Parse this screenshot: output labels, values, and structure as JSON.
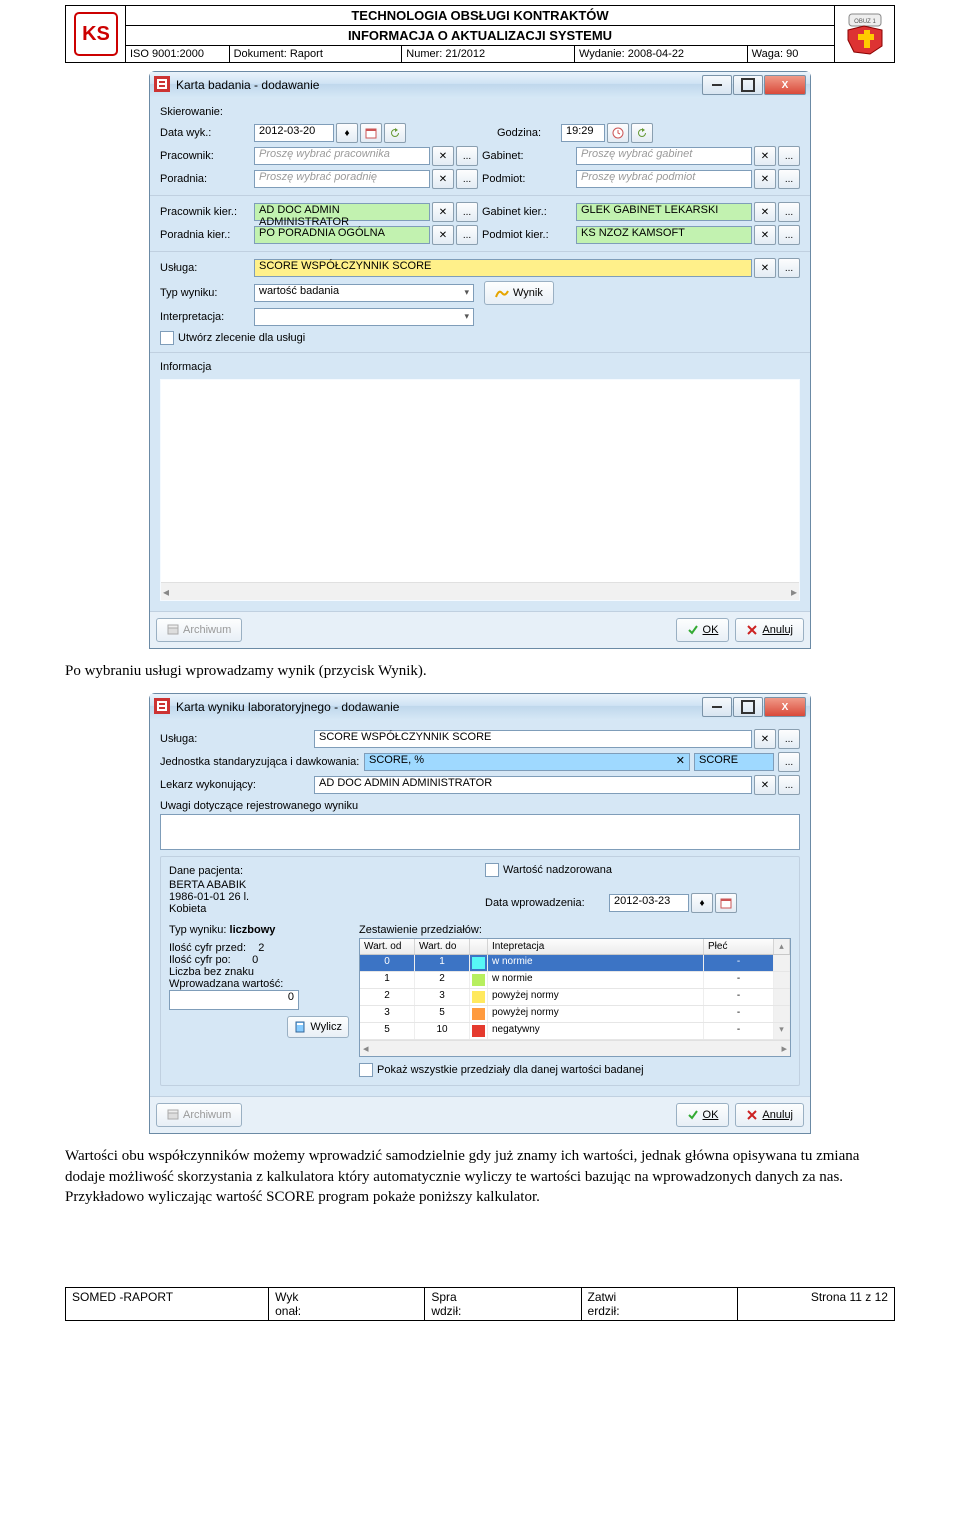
{
  "header": {
    "title1": "TECHNOLOGIA OBSŁUGI KONTRAKTÓW",
    "title2": "INFORMACJA O AKTUALIZACJI SYSTEMU",
    "iso": "ISO 9001:2000",
    "doc": "Dokument: Raport",
    "num": "Numer: 21/2012",
    "wyd": "Wydanie: 2008-04-22",
    "waga": "Waga: 90",
    "badge": "OBUZ 1"
  },
  "dlg1": {
    "title": "Karta badania - dodawanie",
    "sec_skier": "Skierowanie:",
    "l_data": "Data wyk.:",
    "v_data": "2012-03-20",
    "l_godz": "Godzina:",
    "v_godz": "19:29",
    "l_prac": "Pracownik:",
    "ph_prac": "Proszę wybrać pracownika",
    "l_gab": "Gabinet:",
    "ph_gab": "Proszę wybrać gabinet",
    "l_por": "Poradnia:",
    "ph_por": "Proszę wybrać poradnię",
    "l_pod": "Podmiot:",
    "ph_pod": "Proszę wybrać podmiot",
    "l_prack": "Pracownik kier.:",
    "v_prack": "AD DOC ADMIN ADMINISTRATOR",
    "l_gabk": "Gabinet kier.:",
    "v_gabk": "GLEK GABINET LEKARSKI",
    "l_pork": "Poradnia kier.:",
    "v_pork": "PO PORADNIA OGÓLNA",
    "l_podk": "Podmiot kier.:",
    "v_podk": "KS NZOZ KAMSOFT",
    "l_uslug": "Usługa:",
    "v_uslug": "SCORE WSPÓŁCZYNNIK SCORE",
    "l_typ": "Typ wyniku:",
    "v_typ": "wartość badania",
    "btn_wynik": "Wynik",
    "l_interp": "Interpretacja:",
    "chk_zlec": "Utwórz zlecenie dla usługi",
    "l_info": "Informacja",
    "btn_arch": "Archiwum",
    "btn_ok": "OK",
    "btn_anul": "Anuluj"
  },
  "para1": "Po wybraniu usługi wprowadzamy wynik (przycisk Wynik).",
  "dlg2": {
    "title": "Karta wyniku laboratoryjnego - dodawanie",
    "l_uslug": "Usługa:",
    "v_uslug": "SCORE WSPÓŁCZYNNIK SCORE",
    "l_jedn": "Jednostka standaryzująca i dawkowania:",
    "v_jedn": "SCORE, %",
    "v_jedn_r": "SCORE",
    "l_lek": "Lekarz wykonujący:",
    "v_lek": "AD DOC ADMIN ADMINISTRATOR",
    "l_uwagi": "Uwagi dotyczące rejestrowanego wyniku",
    "l_dane": "Dane pacjenta:",
    "v_pac1": "BERTA ABABIK",
    "v_pac2": "1986-01-01 26 l.",
    "v_pac3": "Kobieta",
    "chk_nadz": "Wartość nadzorowana",
    "l_dw": "Data wprowadzenia:",
    "v_dw": "2012-03-23",
    "l_typw": "Typ wyniku:",
    "v_typw": "liczbowy",
    "l_icp": "Ilość cyfr przed:",
    "v_icp": "2",
    "l_ico": "Ilość cyfr po:",
    "v_ico": "0",
    "l_lbz": "Liczba bez znaku",
    "l_wpw": "Wprowadzana wartość:",
    "v_wpw": "0",
    "btn_wyl": "Wylicz",
    "l_zest": "Zestawienie przedziałów:",
    "th": {
      "w1": "Wart. od",
      "w2": "Wart. do",
      "i": "Intepretacja",
      "p": "Płeć"
    },
    "rows": [
      {
        "a": "0",
        "b": "1",
        "c": "cyan",
        "t": "w normie",
        "p": "-"
      },
      {
        "a": "1",
        "b": "2",
        "c": "lime",
        "t": "w normie",
        "p": "-"
      },
      {
        "a": "2",
        "b": "3",
        "c": "yel",
        "t": "powyżej normy",
        "p": "-"
      },
      {
        "a": "3",
        "b": "5",
        "c": "or",
        "t": "powyżej normy",
        "p": "-"
      },
      {
        "a": "5",
        "b": "10",
        "c": "red",
        "t": "negatywny",
        "p": "-"
      }
    ],
    "chk_pokaz": "Pokaż wszystkie przedziały dla danej wartości badanej",
    "btn_arch": "Archiwum",
    "btn_ok": "OK",
    "btn_anul": "Anuluj"
  },
  "para2": "Wartości obu współczynników możemy wprowadzić samodzielnie gdy już znamy ich wartości, jednak główna opisywana tu zmiana dodaje możliwość skorzystania z kalkulatora który automatycznie wyliczy te wartości bazując na wprowadzonych danych za nas. Przykładowo wyliczając wartość SCORE program pokaże poniższy kalkulator.",
  "footer": {
    "c1": "SOMED -RAPORT",
    "c2a": "Wyk",
    "c2b": "onał:",
    "c3a": "Spra",
    "c3b": "wdził:",
    "c4a": "Zatwi",
    "c4b": "erdził:",
    "c5": "Strona 11 z 12"
  }
}
